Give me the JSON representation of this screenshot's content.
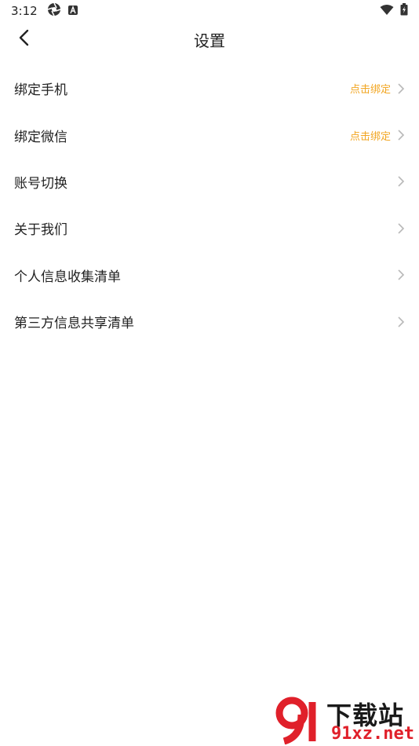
{
  "status_bar": {
    "time": "3:12"
  },
  "header": {
    "title": "设置"
  },
  "settings_list": [
    {
      "label": "绑定手机",
      "action": "点击绑定"
    },
    {
      "label": "绑定微信",
      "action": "点击绑定"
    },
    {
      "label": "账号切换",
      "action": ""
    },
    {
      "label": "关于我们",
      "action": ""
    },
    {
      "label": "个人信息收集清单",
      "action": ""
    },
    {
      "label": "第三方信息共享清单",
      "action": ""
    }
  ],
  "watermark": {
    "cn": "下载站",
    "en": "91xz.net"
  },
  "colors": {
    "accent": "#f2a520",
    "chevron": "#b8b8b8",
    "watermark_red": "#e0202a"
  }
}
